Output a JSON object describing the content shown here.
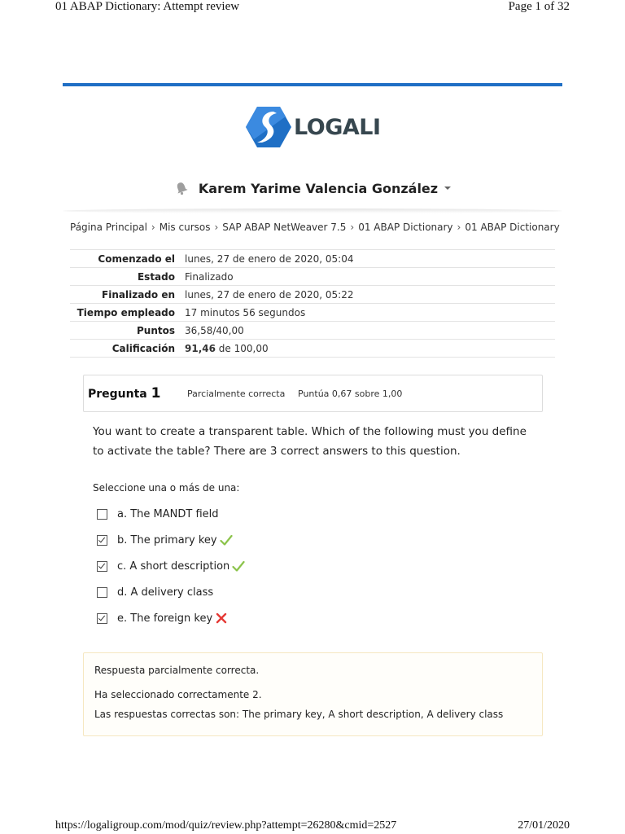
{
  "print": {
    "header_title": "01 ABAP Dictionary: Attempt review",
    "page_of": "Page 1 of 32",
    "footer_url": "https://logaligroup.com/mod/quiz/review.php?attempt=26280&cmid=2527",
    "footer_date": "27/01/2020"
  },
  "brand": {
    "logo_text": "LOGALI",
    "accent": "#1f6fc5",
    "logo_color": "#37474f"
  },
  "user": {
    "name": "Karem Yarime Valencia González",
    "icon": "bell-icon"
  },
  "breadcrumb": [
    "Página Principal",
    "Mis cursos",
    "SAP ABAP NetWeaver 7.5",
    "01 ABAP Dictionary",
    "01 ABAP Dictionary"
  ],
  "summary": [
    {
      "label": "Comenzado el",
      "value": "lunes, 27 de enero de 2020, 05:04"
    },
    {
      "label": "Estado",
      "value": "Finalizado"
    },
    {
      "label": "Finalizado en",
      "value": "lunes, 27 de enero de 2020, 05:22"
    },
    {
      "label": "Tiempo empleado",
      "value": "17 minutos 56 segundos"
    },
    {
      "label": "Puntos",
      "value": "36,58/40,00"
    },
    {
      "label": "Calificación",
      "value_bold": "91,46",
      "value_rest": " de 100,00"
    }
  ],
  "question": {
    "label": "Pregunta",
    "number": "1",
    "state": "Parcialmente correcta",
    "grade": "Puntúa 0,67 sobre 1,00",
    "text": "You want to create a transparent table. Which of the following must you define to activate the table? There are 3 correct answers to this question.",
    "prompt": "Seleccione una o más de una:",
    "answers": [
      {
        "label": "a. The MANDT field",
        "checked": false,
        "mark": ""
      },
      {
        "label": "b. The primary key",
        "checked": true,
        "mark": "correct"
      },
      {
        "label": "c. A short description",
        "checked": true,
        "mark": "correct"
      },
      {
        "label": "d. A delivery class",
        "checked": false,
        "mark": ""
      },
      {
        "label": "e. The foreign key",
        "checked": true,
        "mark": "incorrect"
      }
    ]
  },
  "feedback": {
    "line1": "Respuesta parcialmente correcta.",
    "line2": "Ha seleccionado correctamente 2.",
    "line3": "Las respuestas correctas son: The primary key, A short description, A delivery class"
  },
  "colors": {
    "correct": "#8bc34a",
    "incorrect": "#e53935",
    "feedback_border": "#f6e7c1"
  }
}
